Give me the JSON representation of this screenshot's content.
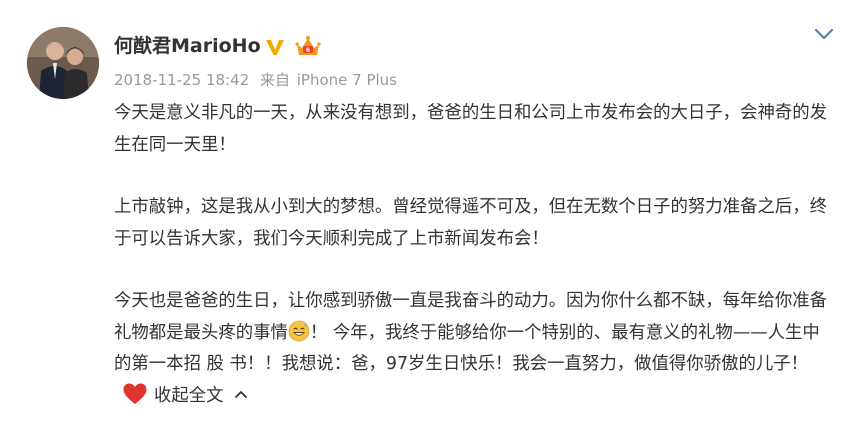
{
  "post": {
    "username": "何猷君MarioHo",
    "verified_icon": "verified-v-icon",
    "member_icon": "vip-member-icon",
    "timestamp": "2018-11-25 18:42",
    "source_prefix": "来自",
    "source_device": "iPhone 7 Plus",
    "paragraphs": [
      "今天是意义非凡的一天，从来没有想到，爸爸的生日和公司上市发布会的大日子，会神奇的发生在同一天里！",
      "上市敲钟，这是我从小到大的梦想。曾经觉得遥不可及，但在无数个日子的努力准备之后，终于可以告诉大家，我们今天顺利完成了上市新闻发布会！"
    ],
    "para3_part1": "今天也是爸爸的生日，让你感到骄傲一直是我奋斗的动力。因为你什么都不缺，每年给你准备礼物都是最头疼的事情",
    "para3_part2": "！ 今年，我终于能够给你一个特别的、最有意义的礼物——人生中的第一本招 股 书！！我想说：爸，97岁生日快乐！我会一直努力，做值得你骄傲的儿子！",
    "emoji_icon": "sweat-smile-emoji-icon",
    "heart_icon": "red-heart-icon",
    "collapse_label": "收起全文",
    "colors": {
      "text": "#333333",
      "meta": "#999999",
      "verified": "#f7a700",
      "heart": "#e0342f",
      "chevron": "#5b7fb3"
    }
  }
}
